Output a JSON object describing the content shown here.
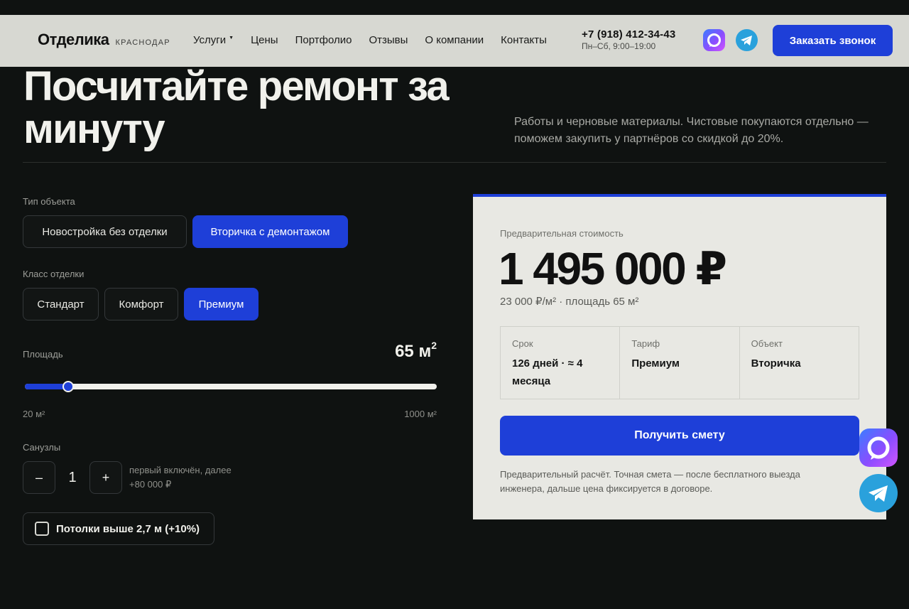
{
  "header": {
    "brand_name": "Отделика",
    "brand_city": "КРАСНОДАР",
    "nav": [
      {
        "label": "Услуги"
      },
      {
        "label": "Цены"
      },
      {
        "label": "Портфолио"
      },
      {
        "label": "Отзывы"
      },
      {
        "label": "О компании"
      },
      {
        "label": "Контакты"
      }
    ],
    "phone": "+7 (918) 412-34-43",
    "hours": "Пн–Сб, 9:00–19:00",
    "cta": "Заказать звонок",
    "icons": [
      "max-messenger-icon",
      "telegram-icon"
    ]
  },
  "hero": {
    "title": "Посчитайте ремонт за минуту",
    "subtitle": "Работы и черновые материалы. Чистовые покупаются отдельно — поможем закупить у партнёров со скидкой до 20%."
  },
  "calculator": {
    "object_type": {
      "label": "Тип объекта",
      "options": [
        "Новостройка без отделки",
        "Вторичка с демонтажом"
      ],
      "selected": 1
    },
    "finish_class": {
      "label": "Класс отделки",
      "options": [
        "Стандарт",
        "Комфорт",
        "Премиум"
      ],
      "selected": 2
    },
    "area": {
      "label": "Площадь",
      "value": "65",
      "unit": "м",
      "unit_sup": "2",
      "min_label": "20 м²",
      "max_label": "1000 м²",
      "min": 20,
      "max": 1000,
      "current": 65
    },
    "bathrooms": {
      "label": "Санузлы",
      "minus": "–",
      "value": "1",
      "plus": "+",
      "note_line1": "первый включён, далее",
      "note_line2": "+80 000 ₽"
    },
    "ceilings": {
      "label": "Потолки выше 2,7 м (+10%)",
      "checked": false
    }
  },
  "result": {
    "label": "Предварительная стоимость",
    "price": "1 495 000 ₽",
    "price_sub": "23 000 ₽/м² · площадь 65 м²",
    "info": [
      {
        "key": "Срок",
        "value": "126 дней · ≈ 4 месяца"
      },
      {
        "key": "Тариф",
        "value": "Премиум"
      },
      {
        "key": "Объект",
        "value": "Вторичка"
      }
    ],
    "button": "Получить смету",
    "note": "Предварительный расчёт. Точная смета — после бесплатного выезда инженера, дальше цена фиксируется в договоре."
  },
  "colors": {
    "accent": "#1e3fd8",
    "background": "#0f1211",
    "header_bg": "#d7d8d2",
    "card_bg": "#e8e8e3"
  }
}
